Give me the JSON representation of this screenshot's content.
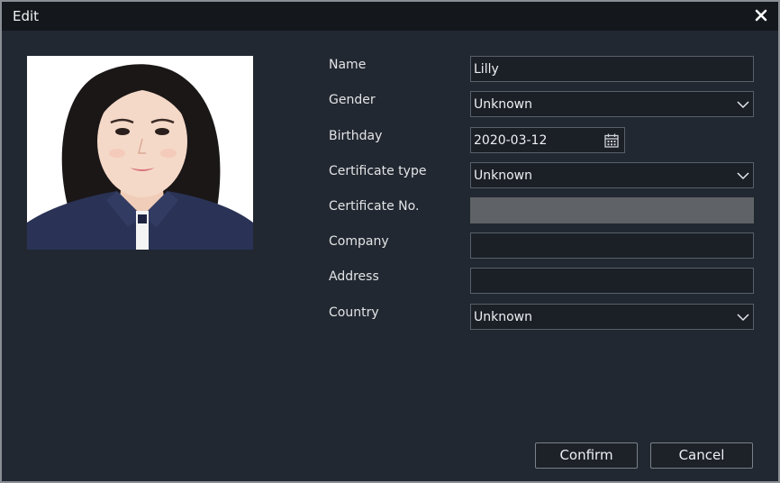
{
  "dialog": {
    "title": "Edit"
  },
  "photo": {
    "alt": "profile-photo"
  },
  "form": {
    "name_label": "Name",
    "name_value": "Lilly",
    "gender_label": "Gender",
    "gender_value": "Unknown",
    "birthday_label": "Birthday",
    "birthday_value": "2020-03-12",
    "cert_type_label": "Certificate type",
    "cert_type_value": "Unknown",
    "cert_no_label": "Certificate No.",
    "cert_no_value": "",
    "company_label": "Company",
    "company_value": "",
    "address_label": "Address",
    "address_value": "",
    "country_label": "Country",
    "country_value": "Unknown"
  },
  "buttons": {
    "confirm": "Confirm",
    "cancel": "Cancel"
  },
  "colors": {
    "background": "#222831",
    "titlebar": "#14181d",
    "field_border": "#596069",
    "disabled_field": "#5f6266"
  }
}
